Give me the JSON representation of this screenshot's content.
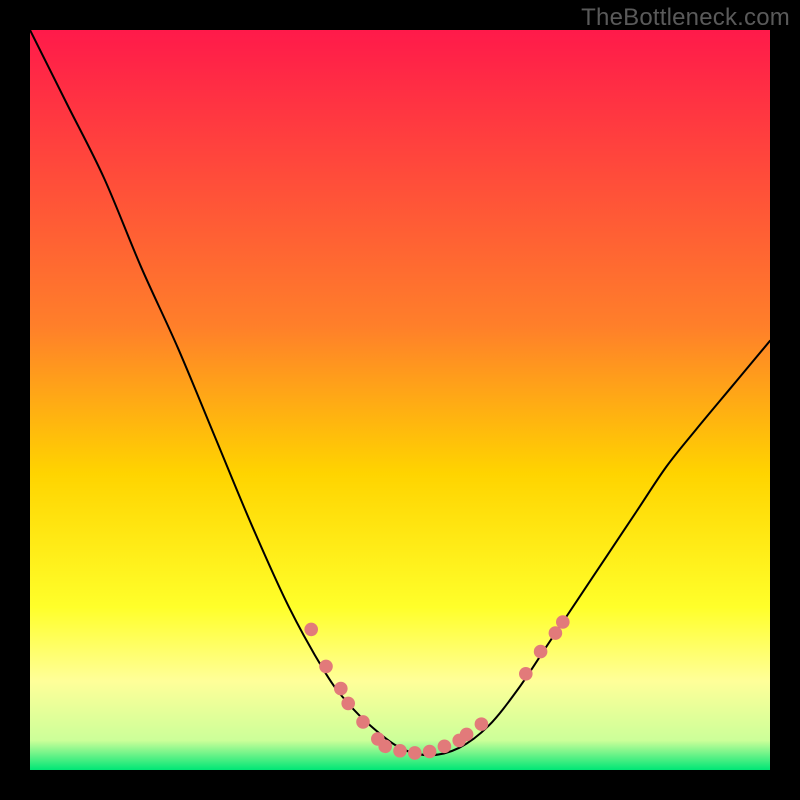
{
  "watermark": "TheBottleneck.com",
  "chart_data": {
    "type": "line",
    "title": "",
    "xlabel": "",
    "ylabel": "",
    "x_range": [
      0,
      100
    ],
    "y_range": [
      0,
      100
    ],
    "legend": false,
    "grid": false,
    "background_gradient_stops": [
      {
        "pos": 0.0,
        "color": "#ff1a4a"
      },
      {
        "pos": 0.4,
        "color": "#ff7f2a"
      },
      {
        "pos": 0.6,
        "color": "#ffd400"
      },
      {
        "pos": 0.78,
        "color": "#ffff2a"
      },
      {
        "pos": 0.88,
        "color": "#ffff99"
      },
      {
        "pos": 0.96,
        "color": "#ccff99"
      },
      {
        "pos": 1.0,
        "color": "#00e676"
      }
    ],
    "series": [
      {
        "name": "bottleneck-curve",
        "color": "#000000",
        "stroke_width": 2,
        "x": [
          0,
          5,
          10,
          15,
          20,
          25,
          30,
          35,
          40,
          43,
          46,
          50,
          54,
          58,
          62,
          66,
          70,
          74,
          78,
          82,
          86,
          90,
          95,
          100
        ],
        "y": [
          100,
          90,
          80,
          68,
          57,
          45,
          33,
          22,
          13,
          9,
          6,
          3,
          2,
          3,
          6,
          11,
          17,
          23,
          29,
          35,
          41,
          46,
          52,
          58
        ]
      }
    ],
    "marker_clusters": [
      {
        "name": "low-bottleneck-markers",
        "color": "#e27a7a",
        "radius": 6.8,
        "points": [
          {
            "x": 38,
            "y": 19
          },
          {
            "x": 40,
            "y": 14
          },
          {
            "x": 42,
            "y": 11
          },
          {
            "x": 43,
            "y": 9
          },
          {
            "x": 45,
            "y": 6.5
          },
          {
            "x": 47,
            "y": 4.2
          },
          {
            "x": 48,
            "y": 3.2
          },
          {
            "x": 50,
            "y": 2.6
          },
          {
            "x": 52,
            "y": 2.3
          },
          {
            "x": 54,
            "y": 2.5
          },
          {
            "x": 56,
            "y": 3.2
          },
          {
            "x": 58,
            "y": 4.0
          },
          {
            "x": 59,
            "y": 4.8
          },
          {
            "x": 61,
            "y": 6.2
          },
          {
            "x": 67,
            "y": 13
          },
          {
            "x": 69,
            "y": 16
          },
          {
            "x": 71,
            "y": 18.5
          },
          {
            "x": 72,
            "y": 20
          }
        ]
      }
    ]
  }
}
